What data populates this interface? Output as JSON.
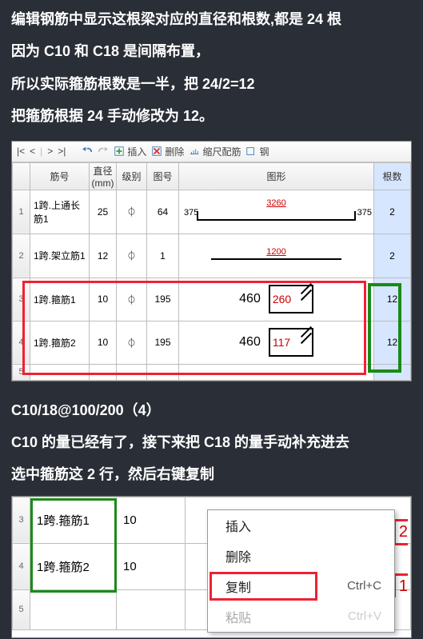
{
  "text": {
    "p1": "编辑钢筋中显示这根梁对应的直径和根数,都是 24 根",
    "p2": "因为 C10 和 C18 是间隔布置，",
    "p3": "所以实际箍筋根数是一半，把 24/2=12",
    "p4": "把箍筋根据 24 手动修改为 12。",
    "p5": "C10/18@100/200（4）",
    "p6": "C10 的量已经有了，接下来把 C18 的量手动补充进去",
    "p7": "选中箍筋这 2 行，然后右键复制"
  },
  "toolbar": {
    "nav_first": "|<",
    "nav_prev": "<",
    "nav_next": ">",
    "nav_last": ">|",
    "insert": "插入",
    "delete": "删除",
    "scale": "缩尺配筋",
    "steel_prefix": "钢"
  },
  "grid1": {
    "headers": {
      "name": "筋号",
      "dia": "直径\n(mm)",
      "grade": "级别",
      "code": "图号",
      "fig": "图形",
      "qty": "根数"
    },
    "rows": [
      {
        "idx": "1",
        "name": "1跨.上通长筋1",
        "dia": "25",
        "grade": "⏀",
        "code": "64",
        "fig": {
          "type": "u",
          "l": "375",
          "c": "3260",
          "r": "375"
        },
        "qty": "2"
      },
      {
        "idx": "2",
        "name": "1跨.架立筋1",
        "dia": "12",
        "grade": "⏀",
        "code": "1",
        "fig": {
          "type": "line",
          "c": "1200"
        },
        "qty": "2"
      },
      {
        "idx": "3",
        "name": "1跨.箍筋1",
        "dia": "10",
        "grade": "⏀",
        "code": "195",
        "fig": {
          "type": "hoop",
          "black": "460",
          "red": "260"
        },
        "qty": "12"
      },
      {
        "idx": "4",
        "name": "1跨.箍筋2",
        "dia": "10",
        "grade": "⏀",
        "code": "195",
        "fig": {
          "type": "hoop",
          "black": "460",
          "red": "117"
        },
        "qty": "12"
      },
      {
        "idx": "5",
        "name": "",
        "dia": "",
        "grade": "",
        "code": "",
        "fig": {
          "type": "empty"
        },
        "qty": ""
      }
    ]
  },
  "grid2": {
    "rows": [
      {
        "idx": "3",
        "name": "1跨.箍筋1",
        "dia": "10"
      },
      {
        "idx": "4",
        "name": "1跨.箍筋2",
        "dia": "10"
      },
      {
        "idx": "5",
        "name": "",
        "dia": ""
      }
    ],
    "side_nums": {
      "top": "2",
      "bottom": "1"
    }
  },
  "ctxmenu": {
    "insert": "插入",
    "delete": "删除",
    "copy": "复制",
    "copy_sc": "Ctrl+C",
    "paste": "粘贴",
    "paste_sc": "Ctrl+V"
  }
}
